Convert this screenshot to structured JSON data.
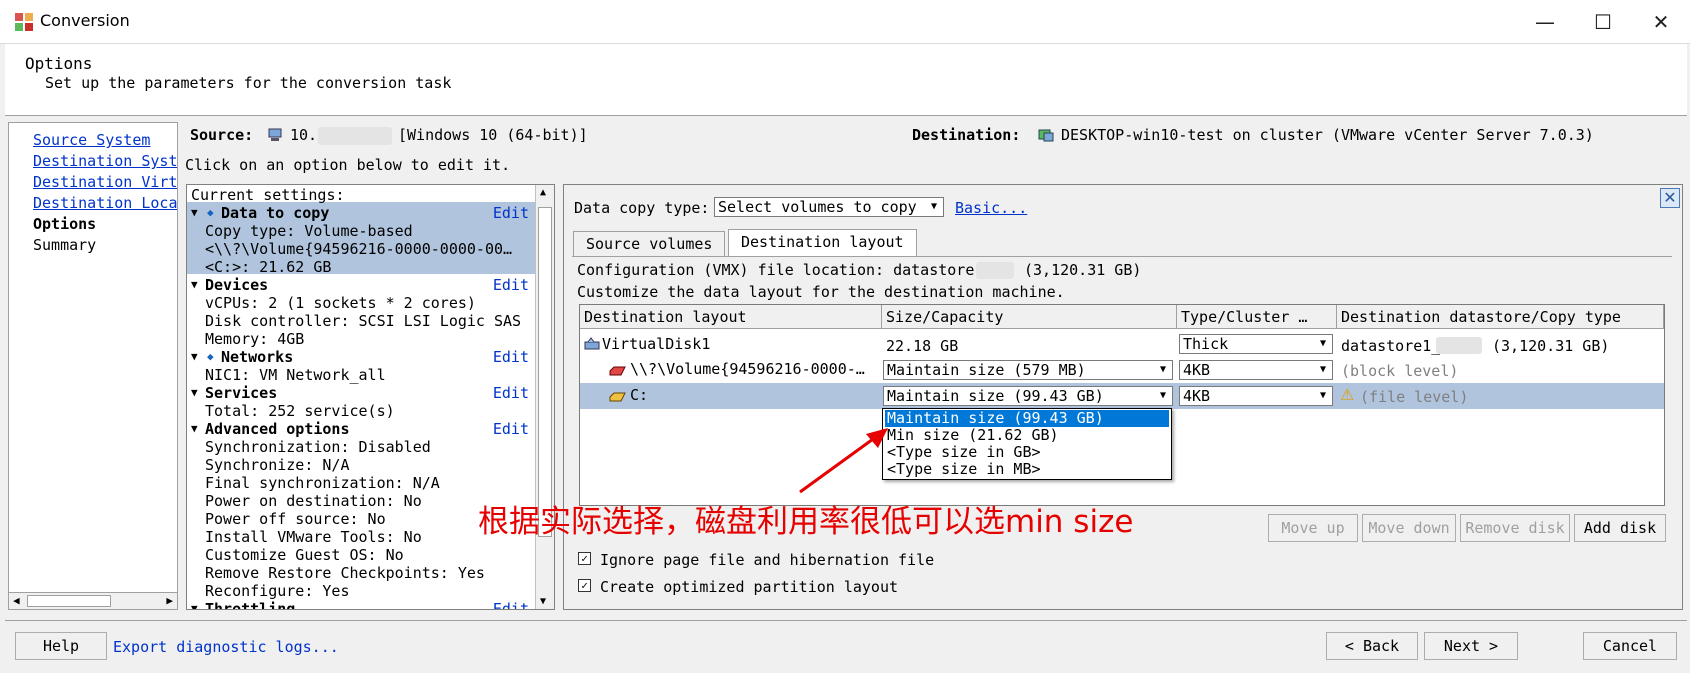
{
  "window": {
    "title": "Conversion"
  },
  "header": {
    "title": "Options",
    "subtitle": "Set up the parameters for the conversion task"
  },
  "nav": [
    {
      "label": "Source System"
    },
    {
      "label": "Destination System"
    },
    {
      "label": "Destination Virtual Machine"
    },
    {
      "label": "Destination Location"
    },
    {
      "label": "Options"
    },
    {
      "label": "Summary"
    }
  ],
  "source": {
    "label": "Source:",
    "value": "10.",
    "os": "[Windows 10 (64-bit)]"
  },
  "destination": {
    "label": "Destination:",
    "value": "DESKTOP-win10-test on cluster (VMware vCenter Server 7.0.3)"
  },
  "instruction": "Click on an option below to edit it.",
  "settings": {
    "header": "Current settings:",
    "edit_label": "Edit",
    "data_to_copy": {
      "title": "Data to copy",
      "lines": [
        "Copy type: Volume-based",
        "<\\\\?\\Volume{94596216-0000-0000-00…",
        "<C:>: 21.62 GB"
      ]
    },
    "devices": {
      "title": "Devices",
      "lines": [
        "vCPUs: 2 (1 sockets * 2 cores)",
        "Disk controller: SCSI LSI Logic SAS",
        "Memory: 4GB"
      ]
    },
    "networks": {
      "title": "Networks",
      "lines": [
        "NIC1: VM Network_all"
      ]
    },
    "services": {
      "title": "Services",
      "lines": [
        "Total: 252 service(s)"
      ]
    },
    "advanced": {
      "title": "Advanced options",
      "lines": [
        "Synchronization: Disabled",
        "Synchronize: N/A",
        "Final synchronization: N/A",
        "Power on destination: No",
        "Power off source: No",
        "Install VMware Tools: No",
        "Customize Guest OS: No",
        "Remove Restore Checkpoints: Yes",
        "Reconfigure: Yes"
      ]
    },
    "throttling": {
      "title": "Throttling"
    }
  },
  "data_copy": {
    "label": "Data copy type:",
    "value": "Select volumes to copy",
    "basic_link": "Basic..."
  },
  "tabs": [
    {
      "label": "Source volumes"
    },
    {
      "label": "Destination layout"
    }
  ],
  "vmx_location": "Configuration (VMX) file location: datastore1_",
  "vmx_capacity": "(3,120.31 GB)",
  "customize_text": "Customize the data layout for the destination machine.",
  "grid": {
    "headers": [
      "Destination layout",
      "Size/Capacity",
      "Type/Cluster …",
      "Destination datastore/Copy type"
    ],
    "rows": [
      {
        "name": "VirtualDisk1",
        "size": "22.18 GB",
        "type": "Thick",
        "ds": "datastore1_",
        "ds_capacity": "(3,120.31 GB)"
      },
      {
        "name": "\\\\?\\Volume{94596216-0000-…",
        "size": "Maintain size (579 MB)",
        "type": "4KB",
        "ds": "(block level)"
      },
      {
        "name": "C:",
        "size": "Maintain size (99.43 GB)",
        "type": "4KB",
        "ds": "(file level)"
      }
    ]
  },
  "dropdown": [
    "Maintain size (99.43 GB)",
    "Min size (21.62 GB)",
    "<Type size in GB>",
    "<Type size in MB>"
  ],
  "disk_buttons": {
    "move_up": "Move up",
    "move_down": "Move down",
    "remove": "Remove disk",
    "add": "Add disk"
  },
  "checkboxes": [
    {
      "label": "Ignore page file and hibernation file",
      "checked": true
    },
    {
      "label": "Create optimized partition layout",
      "checked": true
    }
  ],
  "annotation": "根据实际选择，磁盘利用率很低可以选min size",
  "footer": {
    "help": "Help",
    "export": "Export diagnostic logs...",
    "back": "< Back",
    "next": "Next >",
    "cancel": "Cancel"
  },
  "colors": {
    "selection": "#b0c4de",
    "link": "#0033cc",
    "highlight": "#0078d7",
    "annotation": "#e60000"
  }
}
